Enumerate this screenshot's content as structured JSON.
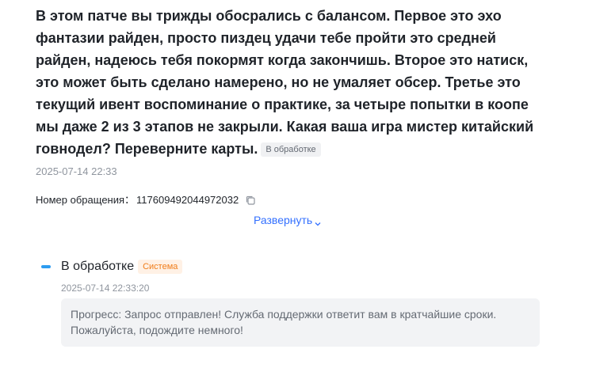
{
  "ticket": {
    "message": "В этом патче вы трижды обосрались с балансом. Первое это эхо фантазии райден, просто пиздец удачи тебе пройти это средней райден, надеюсь тебя покормят когда закончишь. Второе это натиск, это может быть сделано намерено, но не умаляет обсер. Третье это текущий ивент воспоминание о практике, за четыре попытки в коопе мы даже 2 из 3 этапов не закрыли. Какая ваша игра мистер китайский говнодел? Переверните карты.",
    "status_badge": "В обработке",
    "created_at": "2025-07-14 22:33",
    "id_label": "Номер обращения：",
    "id_value": "117609492044972032",
    "copy_icon": "copy-icon",
    "expand_label": "Развернуть",
    "expand_icon": "chevron-down-icon"
  },
  "timeline": {
    "status_title": "В обработке",
    "source_badge": "Система",
    "time": "2025-07-14 22:33:20",
    "progress_text": "Прогресс: Запрос отправлен! Служба поддержки ответит вам в кратчайшие сроки. Пожалуйста, подождите немного!"
  },
  "colors": {
    "accent": "#3370ff",
    "status_marker": "#2d9cf0",
    "system_badge_text": "#f07d1a",
    "system_badge_bg": "#fff1e5",
    "muted_text": "#8f959e"
  }
}
